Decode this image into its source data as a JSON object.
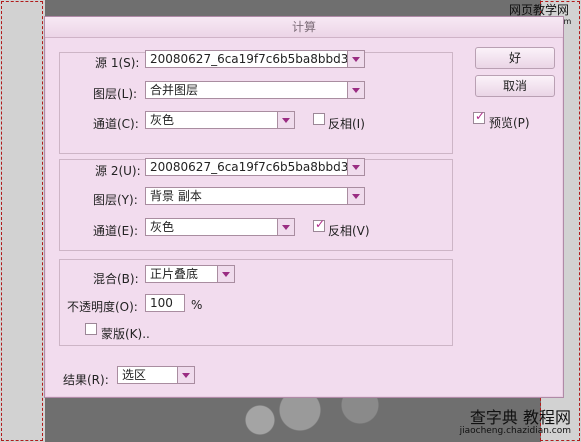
{
  "window": {
    "title": "计算"
  },
  "watermark": {
    "line1": "网页教学网",
    "line2": "www.webjx.com"
  },
  "source1": {
    "label": "源 1(S):",
    "file": "20080627_6ca19f7c6b5ba8bbd3...",
    "layer_label": "图层(L):",
    "layer": "合并图层",
    "channel_label": "通道(C):",
    "channel": "灰色",
    "invert_label": "反相(I)",
    "invert": false
  },
  "source2": {
    "label": "源 2(U):",
    "file": "20080627_6ca19f7c6b5ba8bbd3...",
    "layer_label": "图层(Y):",
    "layer": "背景 副本",
    "channel_label": "通道(E):",
    "channel": "灰色",
    "invert_label": "反相(V)",
    "invert": true
  },
  "blend": {
    "mode_label": "混合(B):",
    "mode": "正片叠底",
    "opacity_label": "不透明度(O):",
    "opacity": "100",
    "percent": "%",
    "mask_label": "蒙版(K)..",
    "mask": false
  },
  "result": {
    "label": "结果(R):",
    "value": "选区"
  },
  "buttons": {
    "ok": "好",
    "cancel": "取消",
    "preview_label": "预览(P)",
    "preview": true
  },
  "footer_watermark": {
    "line1": "查字典 教程网",
    "line2": "jiaocheng.chazidian.com"
  }
}
